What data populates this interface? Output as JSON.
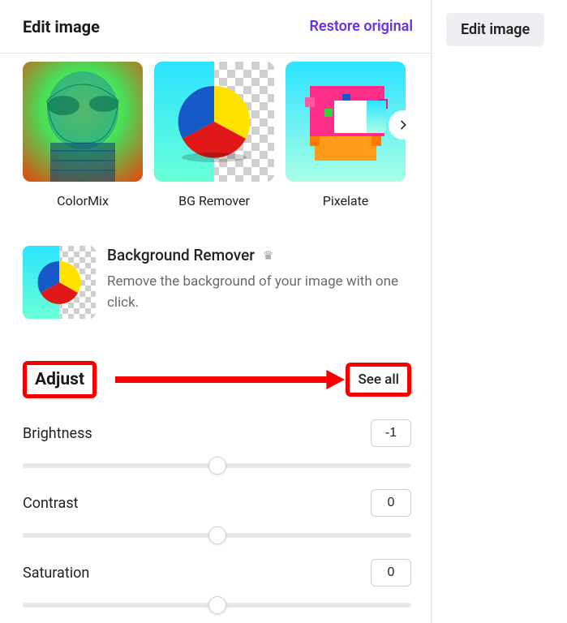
{
  "header": {
    "title": "Edit image",
    "restore": "Restore original"
  },
  "topbar": {
    "edit_button": "Edit image"
  },
  "effects": [
    {
      "name": "ColorMix"
    },
    {
      "name": "BG Remover"
    },
    {
      "name": "Pixelate"
    }
  ],
  "feature": {
    "title": "Background Remover",
    "crown": "♛",
    "desc": "Remove the background of your image with one click."
  },
  "adjust": {
    "title": "Adjust",
    "see_all": "See all",
    "sliders": [
      {
        "label": "Brightness",
        "value": "-1",
        "pos": 50
      },
      {
        "label": "Contrast",
        "value": "0",
        "pos": 50
      },
      {
        "label": "Saturation",
        "value": "0",
        "pos": 50
      }
    ]
  }
}
